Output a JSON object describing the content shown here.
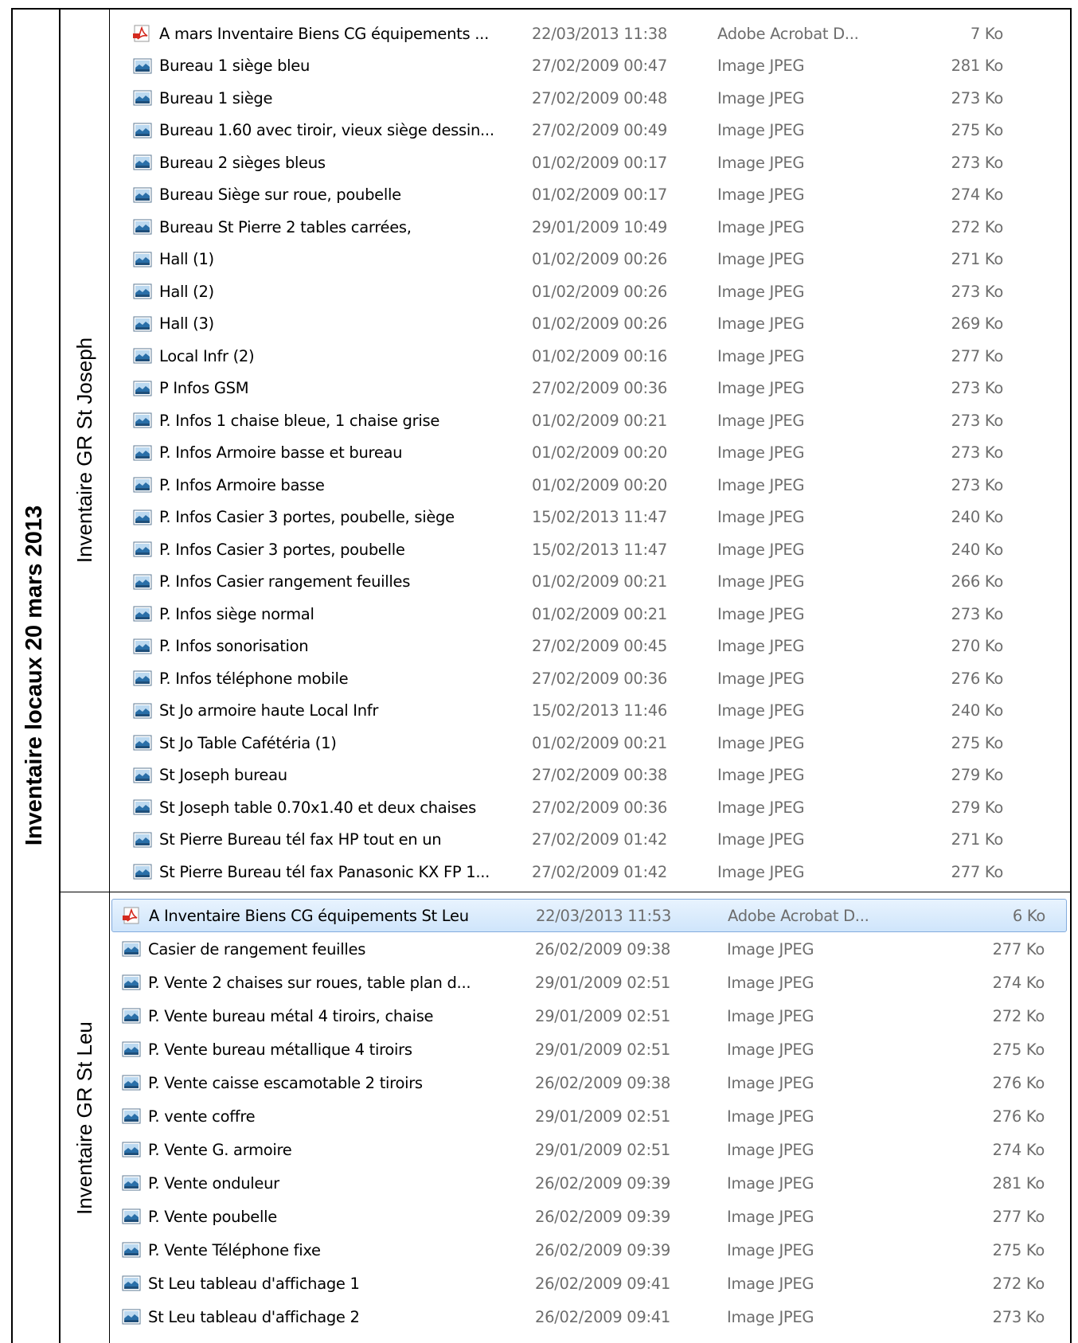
{
  "title": "Inventaire locaux  20 mars 2013",
  "sections": [
    {
      "label": "Inventaire GR St Joseph",
      "files": [
        {
          "icon": "pdf-icon",
          "name": "A mars Inventaire Biens CG équipements ...",
          "date": "22/03/2013 11:38",
          "type": "Adobe Acrobat D...",
          "size": "7 Ko"
        },
        {
          "icon": "image-icon",
          "name": "Bureau 1 siège bleu",
          "date": "27/02/2009 00:47",
          "type": "Image JPEG",
          "size": "281 Ko"
        },
        {
          "icon": "image-icon",
          "name": "Bureau 1 siège",
          "date": "27/02/2009 00:48",
          "type": "Image JPEG",
          "size": "273 Ko"
        },
        {
          "icon": "image-icon",
          "name": "Bureau 1.60 avec tiroir, vieux siège dessin...",
          "date": "27/02/2009 00:49",
          "type": "Image JPEG",
          "size": "275 Ko"
        },
        {
          "icon": "image-icon",
          "name": "Bureau 2 sièges bleus",
          "date": "01/02/2009 00:17",
          "type": "Image JPEG",
          "size": "273 Ko"
        },
        {
          "icon": "image-icon",
          "name": "Bureau Siège sur roue, poubelle",
          "date": "01/02/2009 00:17",
          "type": "Image JPEG",
          "size": "274 Ko"
        },
        {
          "icon": "image-icon",
          "name": "Bureau St Pierre 2 tables carrées,",
          "date": "29/01/2009 10:49",
          "type": "Image JPEG",
          "size": "272 Ko"
        },
        {
          "icon": "image-icon",
          "name": "Hall (1)",
          "date": "01/02/2009 00:26",
          "type": "Image JPEG",
          "size": "271 Ko"
        },
        {
          "icon": "image-icon",
          "name": "Hall (2)",
          "date": "01/02/2009 00:26",
          "type": "Image JPEG",
          "size": "273 Ko"
        },
        {
          "icon": "image-icon",
          "name": "Hall (3)",
          "date": "01/02/2009 00:26",
          "type": "Image JPEG",
          "size": "269 Ko"
        },
        {
          "icon": "image-icon",
          "name": "Local Infr (2)",
          "date": "01/02/2009 00:16",
          "type": "Image JPEG",
          "size": "277 Ko"
        },
        {
          "icon": "image-icon",
          "name": "P Infos GSM",
          "date": "27/02/2009 00:36",
          "type": "Image JPEG",
          "size": "273 Ko"
        },
        {
          "icon": "image-icon",
          "name": "P. Infos 1 chaise bleue, 1 chaise grise",
          "date": "01/02/2009 00:21",
          "type": "Image JPEG",
          "size": "273 Ko"
        },
        {
          "icon": "image-icon",
          "name": "P. Infos Armoire basse et bureau",
          "date": "01/02/2009 00:20",
          "type": "Image JPEG",
          "size": "273 Ko"
        },
        {
          "icon": "image-icon",
          "name": "P. Infos Armoire basse",
          "date": "01/02/2009 00:20",
          "type": "Image JPEG",
          "size": "273 Ko"
        },
        {
          "icon": "image-icon",
          "name": "P. Infos Casier 3 portes, poubelle, siège",
          "date": "15/02/2013 11:47",
          "type": "Image JPEG",
          "size": "240 Ko"
        },
        {
          "icon": "image-icon",
          "name": "P. Infos Casier 3 portes, poubelle",
          "date": "15/02/2013 11:47",
          "type": "Image JPEG",
          "size": "240 Ko"
        },
        {
          "icon": "image-icon",
          "name": "P. Infos Casier rangement feuilles",
          "date": "01/02/2009 00:21",
          "type": "Image JPEG",
          "size": "266 Ko"
        },
        {
          "icon": "image-icon",
          "name": "P. Infos siège normal",
          "date": "01/02/2009 00:21",
          "type": "Image JPEG",
          "size": "273 Ko"
        },
        {
          "icon": "image-icon",
          "name": "P. Infos sonorisation",
          "date": "27/02/2009 00:45",
          "type": "Image JPEG",
          "size": "270 Ko"
        },
        {
          "icon": "image-icon",
          "name": "P. Infos téléphone mobile",
          "date": "27/02/2009 00:36",
          "type": "Image JPEG",
          "size": "276 Ko"
        },
        {
          "icon": "image-icon",
          "name": "St Jo armoire haute Local Infr",
          "date": "15/02/2013 11:46",
          "type": "Image JPEG",
          "size": "240 Ko"
        },
        {
          "icon": "image-icon",
          "name": "St Jo Table Cafétéria (1)",
          "date": "01/02/2009 00:21",
          "type": "Image JPEG",
          "size": "275 Ko"
        },
        {
          "icon": "image-icon",
          "name": "St Joseph bureau",
          "date": "27/02/2009 00:38",
          "type": "Image JPEG",
          "size": "279 Ko"
        },
        {
          "icon": "image-icon",
          "name": "St Joseph table 0.70x1.40 et deux chaises",
          "date": "27/02/2009 00:36",
          "type": "Image JPEG",
          "size": "279 Ko"
        },
        {
          "icon": "image-icon",
          "name": "St Pierre Bureau tél fax HP tout en un",
          "date": "27/02/2009 01:42",
          "type": "Image JPEG",
          "size": "271 Ko"
        },
        {
          "icon": "image-icon",
          "name": "St Pierre Bureau tél fax Panasonic KX FP 1...",
          "date": "27/02/2009 01:42",
          "type": "Image JPEG",
          "size": "277 Ko"
        }
      ]
    },
    {
      "label": "Inventaire GR St Leu",
      "files": [
        {
          "icon": "pdf-icon",
          "name": "A Inventaire Biens CG équipements St Leu",
          "date": "22/03/2013 11:53",
          "type": "Adobe Acrobat D...",
          "size": "6 Ko",
          "selected": true
        },
        {
          "icon": "image-icon",
          "name": "Casier de rangement feuilles",
          "date": "26/02/2009 09:38",
          "type": "Image JPEG",
          "size": "277 Ko"
        },
        {
          "icon": "image-icon",
          "name": "P. Vente 2 chaises sur roues, table plan d...",
          "date": "29/01/2009 02:51",
          "type": "Image JPEG",
          "size": "274 Ko"
        },
        {
          "icon": "image-icon",
          "name": "P. Vente bureau métal 4 tiroirs, chaise",
          "date": "29/01/2009 02:51",
          "type": "Image JPEG",
          "size": "272 Ko"
        },
        {
          "icon": "image-icon",
          "name": "P. Vente bureau métallique 4 tiroirs",
          "date": "29/01/2009 02:51",
          "type": "Image JPEG",
          "size": "275 Ko"
        },
        {
          "icon": "image-icon",
          "name": "P. Vente caisse escamotable 2 tiroirs",
          "date": "26/02/2009 09:38",
          "type": "Image JPEG",
          "size": "276 Ko"
        },
        {
          "icon": "image-icon",
          "name": "P. vente coffre",
          "date": "29/01/2009 02:51",
          "type": "Image JPEG",
          "size": "276 Ko"
        },
        {
          "icon": "image-icon",
          "name": "P. Vente G. armoire",
          "date": "29/01/2009 02:51",
          "type": "Image JPEG",
          "size": "274 Ko"
        },
        {
          "icon": "image-icon",
          "name": "P. Vente onduleur",
          "date": "26/02/2009 09:39",
          "type": "Image JPEG",
          "size": "281 Ko"
        },
        {
          "icon": "image-icon",
          "name": "P. Vente poubelle",
          "date": "26/02/2009 09:39",
          "type": "Image JPEG",
          "size": "277 Ko"
        },
        {
          "icon": "image-icon",
          "name": "P. Vente Téléphone fixe",
          "date": "26/02/2009 09:39",
          "type": "Image JPEG",
          "size": "275 Ko"
        },
        {
          "icon": "image-icon",
          "name": "St Leu tableau d'affichage 1",
          "date": "26/02/2009 09:41",
          "type": "Image JPEG",
          "size": "272 Ko"
        },
        {
          "icon": "image-icon",
          "name": "St Leu tableau d'affichage 2",
          "date": "26/02/2009 09:41",
          "type": "Image JPEG",
          "size": "273 Ko"
        }
      ]
    }
  ],
  "colors": {
    "text": "#000000",
    "meta_text": "#6d6d6d",
    "selection_fill": "#cfe5fb",
    "selection_border": "#84acdd",
    "pdf_red": "#d42a1f",
    "image_blue": "#2a6fa8"
  }
}
